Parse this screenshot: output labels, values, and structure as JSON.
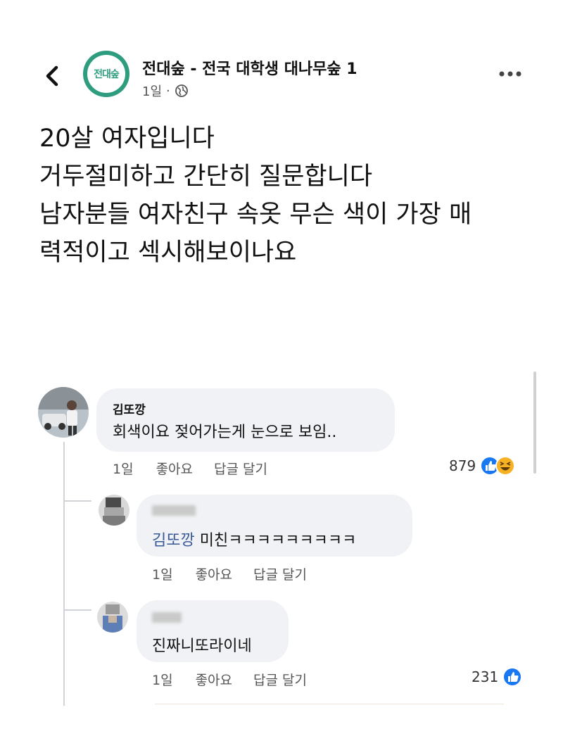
{
  "header": {
    "page_name": "전대숲 - 전국 대학생 대나무숲 1",
    "avatar_text": "전대숲",
    "time": "1일",
    "separator": "·",
    "icons": {
      "back": "chevron-left-icon",
      "privacy": "globe-icon",
      "more": "more-dots-icon"
    },
    "brand_color": "#2e9c7e"
  },
  "post": {
    "lines": [
      "20살 여자입니다",
      "거두절미하고 간단히 질문합니다",
      "남자분들 여자친구 속옷 무슨 색이 가장 매",
      "력적이고 섹시해보이나요"
    ]
  },
  "comments": [
    {
      "author": "김또깡",
      "text": "회색이요 젖어가는게 눈으로 보임..",
      "time": "1일",
      "like_label": "좋아요",
      "reply_label": "답글 달기",
      "reaction_count": "879",
      "reactions": [
        "like-icon",
        "haha-icon"
      ]
    },
    {
      "author_blurred": true,
      "mention": "김또깡",
      "text": " 미친ㅋㅋㅋㅋㅋㅋㅋㅋㅋ",
      "time": "1일",
      "like_label": "좋아요",
      "reply_label": "답글 달기"
    },
    {
      "author_blurred": true,
      "text": "진짜니또라이네",
      "time": "1일",
      "like_label": "좋아요",
      "reply_label": "답글 달기",
      "reaction_count": "231",
      "reactions": [
        "like-icon"
      ]
    }
  ],
  "colors": {
    "like_blue": "#1877f2",
    "haha_yellow": "#f7b125",
    "bubble_bg": "#f0f2f5",
    "mention": "#385898"
  }
}
